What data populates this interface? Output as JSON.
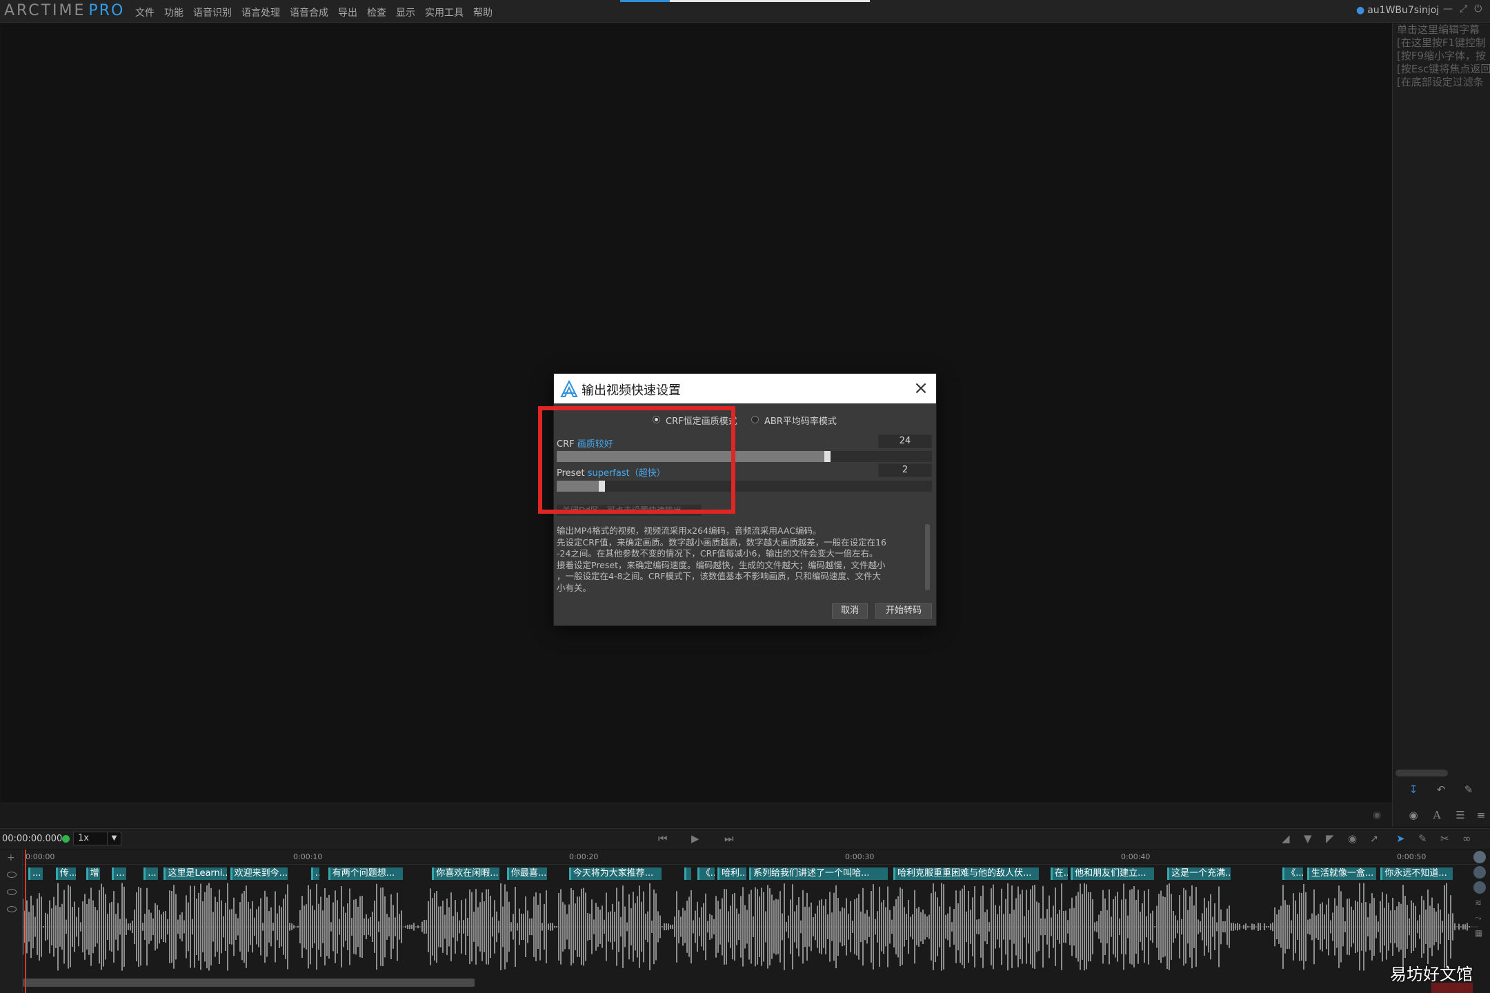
{
  "app": {
    "logo_main": "ARCTIME",
    "logo_pro": "PRO",
    "menu": [
      "文件",
      "功能",
      "语音识别",
      "语言处理",
      "语音合成",
      "导出",
      "检查",
      "显示",
      "实用工具",
      "帮助"
    ],
    "user": "au1WBu7sinjoj",
    "top_progress": 0.2
  },
  "right_panel": {
    "hint_lines": [
      "单击这里编辑字幕",
      "[在这里按F1键控制",
      "[按F9缩小字体，按",
      "[按Esc键将焦点返回",
      "[在底部设定过滤条"
    ]
  },
  "transport": {
    "timecode": "00:00:00.000",
    "speed": "1x"
  },
  "timeline": {
    "ruler": [
      "0:00:00",
      "0:00:10",
      "0:00:20",
      "0:00:30",
      "0:00:40",
      "0:00:50"
    ],
    "subtitles": [
      {
        "text": "...",
        "start": 0.0,
        "w": 0.01
      },
      {
        "text": "传...",
        "start": 0.019,
        "w": 0.014
      },
      {
        "text": "增",
        "start": 0.04,
        "w": 0.01
      },
      {
        "text": "...",
        "start": 0.058,
        "w": 0.01
      },
      {
        "text": "...",
        "start": 0.08,
        "w": 0.01
      },
      {
        "text": "这里是Learni...",
        "start": 0.094,
        "w": 0.044
      },
      {
        "text": "欢迎来到今...",
        "start": 0.14,
        "w": 0.04
      },
      {
        "text": "...",
        "start": 0.196,
        "w": 0.006
      },
      {
        "text": "有两个问题想...",
        "start": 0.208,
        "w": 0.052
      },
      {
        "text": "你喜欢在闲暇...",
        "start": 0.28,
        "w": 0.047
      },
      {
        "text": "你最喜...",
        "start": 0.332,
        "w": 0.028
      },
      {
        "text": "今天将为大家推荐...",
        "start": 0.375,
        "w": 0.064
      },
      {
        "text": "",
        "start": 0.455,
        "w": 0.005
      },
      {
        "text": "《...",
        "start": 0.464,
        "w": 0.012
      },
      {
        "text": "哈利...",
        "start": 0.478,
        "w": 0.02
      },
      {
        "text": "系列给我们讲述了一个叫哈...",
        "start": 0.5,
        "w": 0.096
      },
      {
        "text": "哈利克服重重困难与他的敌人伏...",
        "start": 0.6,
        "w": 0.101
      },
      {
        "text": "在...",
        "start": 0.709,
        "w": 0.012
      },
      {
        "text": "他和朋友们建立...",
        "start": 0.723,
        "w": 0.058
      },
      {
        "text": "这是一个充满...",
        "start": 0.79,
        "w": 0.044
      },
      {
        "text": "《...",
        "start": 0.87,
        "w": 0.014
      },
      {
        "text": "生活就像一盒...",
        "start": 0.887,
        "w": 0.048
      },
      {
        "text": "你永远不知道...",
        "start": 0.938,
        "w": 0.05
      }
    ]
  },
  "dialog": {
    "title": "输出视频快速设置",
    "mode_crf": "CRF恒定画质模式",
    "mode_abr": "ABR平均码率模式",
    "crf_label": "CRF",
    "crf_quality": "画质较好",
    "crf_value": "24",
    "crf_fraction": 0.72,
    "preset_label": "Preset",
    "preset_name": "superfast（超快）",
    "preset_value": "2",
    "preset_fraction": 0.12,
    "hidden_option": "关闭Dd区，可点击设置快速输出",
    "description": [
      "输出MP4格式的视频，视频流采用x264编码，音频流采用AAC编码。",
      "先设定CRF值，来确定画质。数字越小画质越高，数字越大画质越差，一般在设定在16",
      "-24之间。在其他参数不变的情况下，CRF值每减小6，输出的文件会变大一倍左右。",
      "接着设定Preset，来确定编码速度。编码越快，生成的文件越大；编码越慢，文件越小",
      "，一般设定在4-8之间。CRF模式下，该数值基本不影响画质，只和编码速度、文件大",
      "小有关。"
    ],
    "cancel": "取消",
    "start": "开始转码"
  },
  "watermark": "易坊好文馆"
}
